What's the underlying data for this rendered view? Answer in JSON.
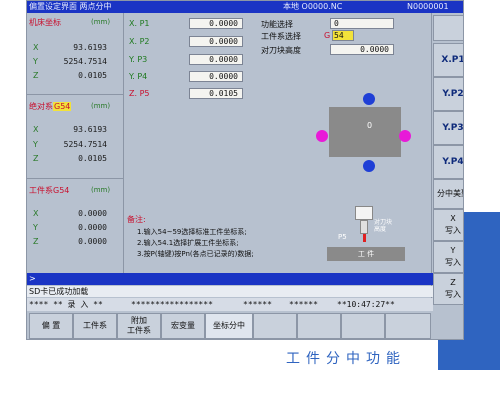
{
  "titlebar": {
    "left": "偏置设定界面 两点分中",
    "program": "本地 O0000.NC",
    "block": "N0000001"
  },
  "colors": {
    "titlebar": "#1a34c4",
    "screen_bg": "#b7c1cf",
    "accent": "#2f64c0",
    "dot_blue": "#1f3fd6",
    "dot_magenta": "#e81ad8",
    "offset_badge": "#f2e23a"
  },
  "machine": {
    "label": "机床坐标",
    "unit": "(mm)",
    "rows": [
      {
        "axis": "X",
        "value": "93.6193"
      },
      {
        "axis": "Y",
        "value": "5254.7514"
      },
      {
        "axis": "Z",
        "value": "0.0105"
      }
    ]
  },
  "absolute": {
    "label": "绝对系",
    "badge": "G54",
    "unit": "(mm)",
    "rows": [
      {
        "axis": "X",
        "value": "93.6193"
      },
      {
        "axis": "Y",
        "value": "5254.7514"
      },
      {
        "axis": "Z",
        "value": "0.0105"
      }
    ]
  },
  "workpiece": {
    "label": "工件系",
    "badge": "G54",
    "unit": "(mm)",
    "rows": [
      {
        "axis": "X",
        "value": "0.0000"
      },
      {
        "axis": "Y",
        "value": "0.0000"
      },
      {
        "axis": "Z",
        "value": "0.0000"
      }
    ]
  },
  "points": [
    {
      "label": "X. P1",
      "value": "0.0000"
    },
    {
      "label": "X. P2",
      "value": "0.0000"
    },
    {
      "label": "Y. P3",
      "value": "0.0000"
    },
    {
      "label": "Y. P4",
      "value": "0.0000"
    },
    {
      "label": "Z. P5",
      "value": "0.0105"
    }
  ],
  "settings": {
    "function_label": "功能选择",
    "function_value": "0",
    "wcs_label": "工件系选择",
    "wcs_prefix": "G",
    "wcs_value": "54",
    "tool_label": "对刀块高度",
    "tool_value": "0.0000"
  },
  "diagram": {
    "center_label": "0",
    "p5_label": "P5",
    "tool_note": "对刀块高度",
    "block_label": "工 件"
  },
  "notes": {
    "title": "备注:",
    "lines": [
      "1.输入54~59选择标准工件坐标系;",
      "2.输入54.1选择扩展工件坐标系;",
      "3.按P(轴键)按Pn(各点已记录的)数据;"
    ]
  },
  "message": "SD卡已成功加载",
  "status": {
    "left": "**** ** 录 入 **",
    "mid1": "*****************",
    "mid2": "******",
    "mid3": "******",
    "time": "**10:47:27**"
  },
  "right_softkeys": [
    "X.P1",
    "Y.P2",
    "Y.P3",
    "Y.P4",
    "分中美聚",
    "X\n写入",
    "Y\n写入",
    "Z\n写入"
  ],
  "bottom_softkeys": [
    "偏 置",
    "工件系",
    "附加\n工件系",
    "宏变量",
    "坐标分中",
    "",
    "",
    "",
    ""
  ],
  "caption": "工件分中功能"
}
